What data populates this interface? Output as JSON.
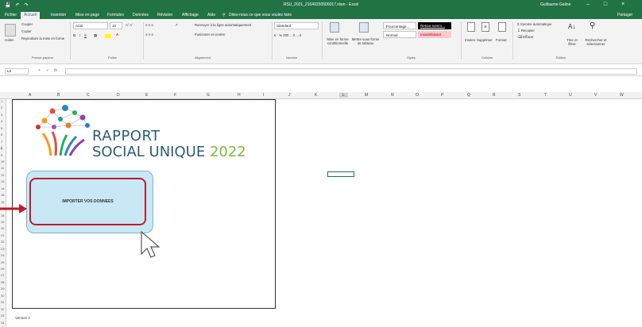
{
  "window": {
    "title": "RSU_2021_21640230500017.xlsm - Excel",
    "user": "Guillaume Galine",
    "share_label": "Partager"
  },
  "tabs": [
    "Fichier",
    "Accueil",
    "Insertion",
    "Mise en page",
    "Formules",
    "Données",
    "Révision",
    "Affichage",
    "Aide"
  ],
  "tell_me": "Dites-nous ce que vous voulez faire",
  "ribbon": {
    "clipboard": {
      "paste": "Coller",
      "cut": "Couper",
      "copy": "Copier",
      "format_painter": "Reproduire la mise en forme",
      "label": "Presse-papiers"
    },
    "font": {
      "name": "Arial",
      "size": "10",
      "label": "Police"
    },
    "alignment": {
      "wrap": "Renvoyer à la ligne automatiquement",
      "merge": "Fusionner et centrer",
      "label": "Alignement"
    },
    "number": {
      "format": "Standard",
      "label": "Nombre"
    },
    "styles": {
      "conditional": "Mise en forme conditionnelle",
      "table": "Mettre sous forme de tableau",
      "cells": [
        "Pourcentage...",
        "Retour somm...",
        "Normal",
        "Insatisfaisant"
      ],
      "label": "Styles"
    },
    "cells": {
      "insert": "Insérer",
      "delete": "Supprimer",
      "format": "Format",
      "label": "Cellules"
    },
    "editing": {
      "autosum": "Somme automatique",
      "fill": "Recopier",
      "clear": "Effacer",
      "sort": "Trier et filtrer",
      "find": "Rechercher et sélectionner",
      "label": "Édition"
    }
  },
  "formula_bar": {
    "name_box": "L8",
    "fx": "fx",
    "value": ""
  },
  "columns": [
    "A",
    "B",
    "C",
    "D",
    "E",
    "F",
    "G",
    "H",
    "I",
    "J",
    "K",
    "L",
    "M",
    "N",
    "O",
    "P",
    "Q",
    "R",
    "S",
    "T",
    "U",
    "V",
    "W"
  ],
  "rows": [
    "1",
    "2",
    "3",
    "4",
    "5",
    "6",
    "7",
    "8",
    "9",
    "10",
    "11",
    "12",
    "13",
    "14",
    "15",
    "16",
    "17",
    "18",
    "19",
    "20",
    "21",
    "22",
    "23",
    "24",
    "25",
    "26",
    "27",
    "28",
    "29",
    "30",
    "31",
    "32",
    "33",
    "34"
  ],
  "sheet": {
    "title_line1": "RAPPORT",
    "title_line2": "SOCIAL UNIQUE",
    "title_year": "2022",
    "import_button": "IMPORTER VOS DONNEES",
    "version": "Version 4"
  },
  "colors": {
    "excel_green": "#217346",
    "title_blue": "#2d5c74",
    "year_green": "#7fb842",
    "button_fill": "#c8e8f5",
    "button_border": "#c0192d",
    "arrow": "#c0192d"
  }
}
